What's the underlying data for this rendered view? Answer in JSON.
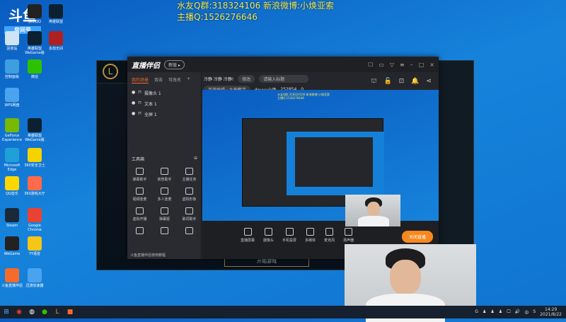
{
  "overlay": {
    "line1": "水友Q群:318324106 新浪微博:小焕亚索",
    "line2": "主播Q:1526276646"
  },
  "logo": {
    "text": "斗鱼",
    "room_label": "房间号",
    "room_no": "25285"
  },
  "desktop_icons": [
    {
      "label": "回收站",
      "color": "#cfe3f5"
    },
    {
      "label": "腾讯QQ",
      "color": "#222"
    },
    {
      "label": "英雄联盟",
      "color": "#0b2030"
    },
    {
      "label": "控制面板",
      "color": "#3d9ee0"
    },
    {
      "label": "英雄联盟WeGame版",
      "color": "#0b2030"
    },
    {
      "label": "永劫无间",
      "color": "#b02020"
    },
    {
      "label": "WPS网盘",
      "color": "#4aa3ef"
    },
    {
      "label": "微信",
      "color": "#2dc100"
    },
    {
      "label": "GeForce Experience",
      "color": "#76b900"
    },
    {
      "label": "英雄联盟WeGame版",
      "color": "#0b2030"
    },
    {
      "label": "Microsoft Edge",
      "color": "#1fa0d8"
    },
    {
      "label": "360安全卫士",
      "color": "#f5d300"
    },
    {
      "label": "QQ音乐",
      "color": "#ffd700"
    },
    {
      "label": "360游戏大厅",
      "color": "#ff6b4a"
    },
    {
      "label": "Steam",
      "color": "#1b2838"
    },
    {
      "label": "Google Chrome",
      "color": "#e94235"
    },
    {
      "label": "WeGame",
      "color": "#222"
    },
    {
      "label": "YY语音",
      "color": "#f5c518"
    },
    {
      "label": "斗鱼直播伴侣",
      "color": "#f56b2a"
    },
    {
      "label": "迅游加速器",
      "color": "#4aa3ef"
    }
  ],
  "lol": {
    "logo": "L",
    "play_label": "开始游戏"
  },
  "app": {
    "brand": "直播伴侣",
    "version": "新版 ▸",
    "controls": [
      "☐",
      "▭",
      "▽",
      "≡",
      "–",
      "□",
      "×"
    ],
    "tabs": [
      "我的场景",
      "双击",
      "可改名",
      "+"
    ],
    "sources": [
      "摄像头 1",
      "文本 1",
      "全屏 1"
    ],
    "title": "冷静 冷静 冷静!",
    "edit": "修改",
    "title_input": "请输入标题",
    "category": "英雄联盟 · 大神教学",
    "account": "douyu小焕",
    "room_id": "252854",
    "hot": "0",
    "actions": [
      "⛫",
      "🔓",
      "⊡",
      "🔔",
      "⋖"
    ],
    "toolbox_title": "工具箱",
    "tools": [
      "弹幕助手",
      "房管助手",
      "主播任务",
      "视频连麦",
      "多人连麦",
      "虚拟形象",
      "虚拟开播",
      "弹幕姬",
      "歌词助手",
      "",
      "",
      ""
    ],
    "notice": "斗鱼直播伴侣使用教程",
    "preview_text": [
      "水友Q群:318324106 新浪微博:小焕亚索",
      "主播Q:1526276646"
    ],
    "bottom_tools": [
      "直播屏幕",
      "摄像头",
      "手机投屏",
      "多媒体",
      "麦克风",
      "扬声器"
    ],
    "live_button": "关闭直播"
  },
  "taskbar": {
    "tray": [
      "G",
      "♟",
      "♟",
      "♟",
      "🖵",
      "🔊",
      "中",
      "S"
    ],
    "time": "14:29",
    "date": "2021/8/22"
  }
}
